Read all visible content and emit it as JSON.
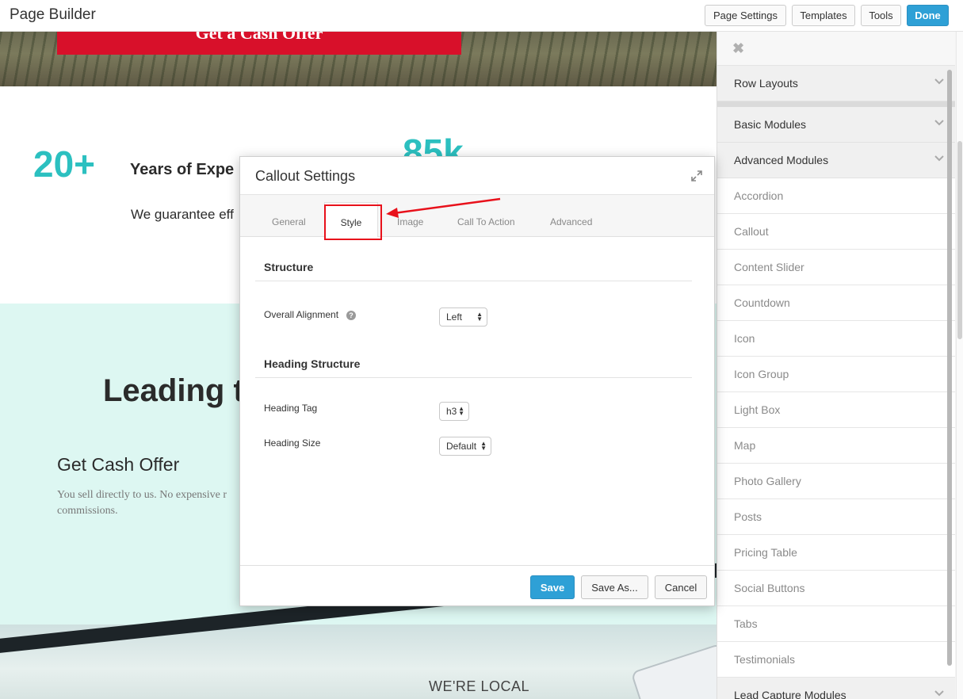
{
  "topbar": {
    "title": "Page Builder",
    "buttons": {
      "page_settings": "Page Settings",
      "templates": "Templates",
      "tools": "Tools",
      "done": "Done"
    }
  },
  "canvas": {
    "hero_cta": "Get a Cash Offer",
    "stat_number": "20+",
    "stat_label": "Years of Expe",
    "stat_number_2": "85k",
    "stat_sub": "We guarantee eff",
    "leading_heading": "Leading t",
    "get_cash_offer_title": "Get Cash Offer",
    "get_cash_offer_text": "You sell directly to us. No expensive r commissions.",
    "we_are_local": "WE'RE LOCAL"
  },
  "panel": {
    "close_icon": "close-icon",
    "sections": {
      "row_layouts": "Row Layouts",
      "basic_modules": "Basic Modules",
      "advanced_modules": "Advanced Modules",
      "lead_capture_modules": "Lead Capture Modules"
    },
    "modules": [
      "Accordion",
      "Callout",
      "Content Slider",
      "Countdown",
      "Icon",
      "Icon Group",
      "Light Box",
      "Map",
      "Photo Gallery",
      "Posts",
      "Pricing Table",
      "Social Buttons",
      "Tabs",
      "Testimonials"
    ]
  },
  "modal": {
    "title": "Callout Settings",
    "tabs": [
      "General",
      "Style",
      "Image",
      "Call To Action",
      "Advanced"
    ],
    "active_tab": "Style",
    "structure": {
      "title": "Structure",
      "overall_alignment_label": "Overall Alignment",
      "overall_alignment_value": "Left"
    },
    "heading_structure": {
      "title": "Heading Structure",
      "heading_tag_label": "Heading Tag",
      "heading_tag_value": "h3",
      "heading_size_label": "Heading Size",
      "heading_size_value": "Default"
    },
    "buttons": {
      "save": "Save",
      "save_as": "Save As...",
      "cancel": "Cancel"
    }
  },
  "colors": {
    "accent": "#2ea0d6",
    "teal": "#2cc0c0",
    "highlight": "#e8111b",
    "cta_red": "#d8102a"
  }
}
